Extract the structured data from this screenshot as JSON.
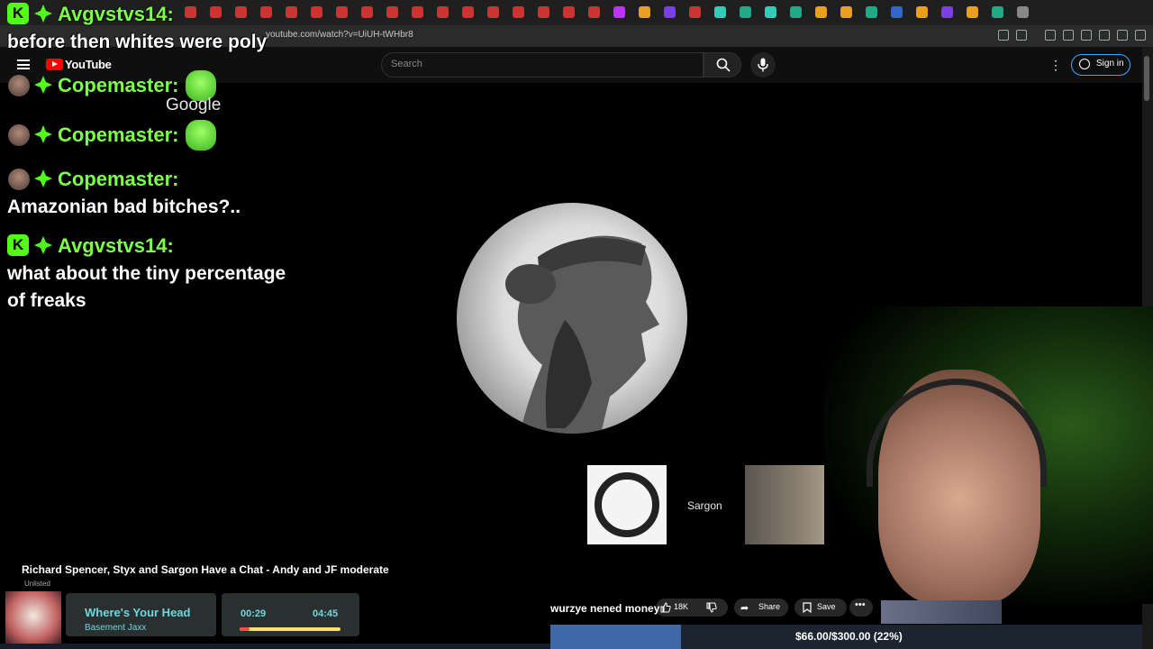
{
  "browser": {
    "url": "youtube.com/watch?v=UiUH-tWHbr8"
  },
  "youtube": {
    "logo_text": "YouTube",
    "search_placeholder": "Search",
    "signin_label": "Sign in"
  },
  "chat": {
    "messages": [
      {
        "user": "Avgvstvs14:",
        "text": "before then whites were poly"
      },
      {
        "user": "Copemaster:",
        "emote_caption": "Google"
      },
      {
        "user": "Copemaster:"
      },
      {
        "user": "Copemaster:",
        "text": "Amazonian bad bitches?.."
      },
      {
        "user": "Avgvstvs14:",
        "text_line1": "what about the tiny percentage",
        "text_line2": "of freaks"
      }
    ],
    "kick_badge": "K"
  },
  "video": {
    "participant_name": "Sargon",
    "title": "Richard Spencer, Styx and Sargon Have a Chat - Andy and JF moderate",
    "visibility": "Unlisted",
    "caption": "wurzye nened money",
    "likes": "18K",
    "share_label": "Share",
    "save_label": "Save"
  },
  "now_playing": {
    "song": "Where's Your Head",
    "artist": "Basement Jaxx",
    "elapsed": "00:29",
    "total": "04:45",
    "progress_fraction": 0.1
  },
  "goal": {
    "label": "$66.00/$300.00 (22%)",
    "fraction": 0.22
  },
  "colors": {
    "chat_name": "#7dff4a",
    "youtube_red": "#ff0000",
    "kick_green": "#53fc18",
    "goal_fill": "#3d6aa6"
  }
}
